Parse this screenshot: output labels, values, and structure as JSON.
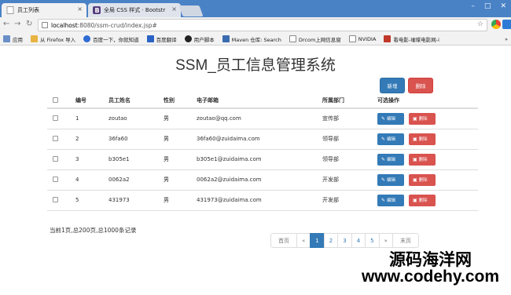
{
  "browser": {
    "tabs": [
      {
        "title": "员工列表"
      },
      {
        "title": "全局 CSS 样式 · Bootstr"
      }
    ],
    "url_host": "localhost",
    "url_path": ":8080/ssm-crud/index.jsp#"
  },
  "bookmarks": [
    {
      "label": "应用",
      "color": "#6a8fc8"
    },
    {
      "label": "从 Firefox 导入",
      "color": "#e8b341"
    },
    {
      "label": "百度一下，你就知道",
      "color": "#2f6bd3"
    },
    {
      "label": "百度翻译",
      "color": "#2a63c4"
    },
    {
      "label": "用户脚本",
      "color": "#222222"
    },
    {
      "label": "Maven 仓库: Search",
      "color": "#3a6bb0"
    },
    {
      "label": "Drcom上网信息窗",
      "color": "#888888"
    },
    {
      "label": "NVIDIA",
      "color": "#777777"
    },
    {
      "label": "看电影-璀璨电影网-i",
      "color": "#c0392b"
    }
  ],
  "page": {
    "title": "SSM_员工信息管理系统",
    "add_label": "新增",
    "delete_label": "删除"
  },
  "table": {
    "headers": [
      "编号",
      "员工姓名",
      "性别",
      "电子邮箱",
      "所属部门",
      "可选操作"
    ],
    "rows": [
      {
        "id": "1",
        "name": "zoutao",
        "gender": "男",
        "email": "zoutao@qq.com",
        "dept": "宣传部"
      },
      {
        "id": "2",
        "name": "36fa60",
        "gender": "男",
        "email": "36fa60@zuidaima.com",
        "dept": "领导部"
      },
      {
        "id": "3",
        "name": "b305e1",
        "gender": "男",
        "email": "b305e1@zuidaima.com",
        "dept": "领导部"
      },
      {
        "id": "4",
        "name": "0062a2",
        "gender": "男",
        "email": "0062a2@zuidaima.com",
        "dept": "开发部"
      },
      {
        "id": "5",
        "name": "431973",
        "gender": "男",
        "email": "431973@zuidaima.com",
        "dept": "开发部"
      }
    ],
    "edit_label": "编辑",
    "row_delete_label": "删除"
  },
  "pagination": {
    "info": "当前1页,总200页,总1000条记录",
    "first": "首页",
    "prev": "«",
    "pages": [
      "1",
      "2",
      "3",
      "4",
      "5"
    ],
    "next": "»",
    "last": "末页",
    "active": "1"
  },
  "watermark": {
    "line1": "源码海洋网",
    "line2": "www.codehy.com"
  }
}
